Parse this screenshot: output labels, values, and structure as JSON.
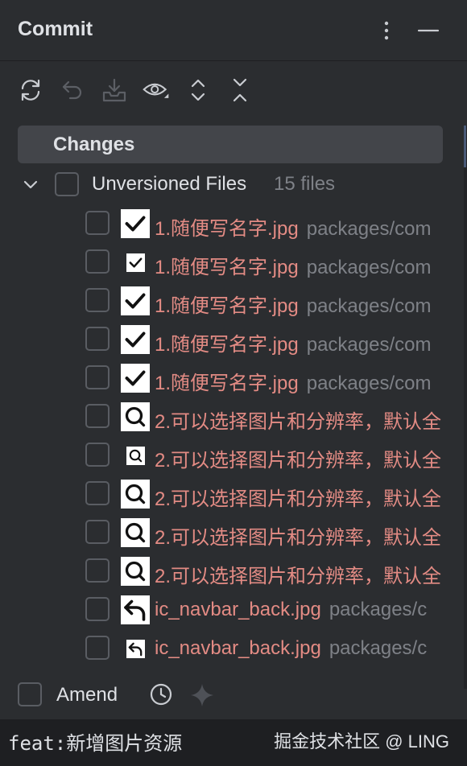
{
  "header": {
    "title": "Commit"
  },
  "changes_tab": {
    "label": "Changes"
  },
  "group": {
    "label": "Unversioned Files",
    "count": "15 files"
  },
  "files": [
    {
      "name": "1.随便写名字.jpg",
      "path": "packages/com",
      "thumb": "check",
      "thumb_size": "big"
    },
    {
      "name": "1.随便写名字.jpg",
      "path": "packages/com",
      "thumb": "check",
      "thumb_size": "small"
    },
    {
      "name": "1.随便写名字.jpg",
      "path": "packages/com",
      "thumb": "check",
      "thumb_size": "big"
    },
    {
      "name": "1.随便写名字.jpg",
      "path": "packages/com",
      "thumb": "check",
      "thumb_size": "big"
    },
    {
      "name": "1.随便写名字.jpg",
      "path": "packages/com",
      "thumb": "check",
      "thumb_size": "big"
    },
    {
      "name": "2.可以选择图片和分辨率，默认全",
      "path": "",
      "thumb": "search",
      "thumb_size": "big"
    },
    {
      "name": "2.可以选择图片和分辨率，默认全",
      "path": "",
      "thumb": "search",
      "thumb_size": "small"
    },
    {
      "name": "2.可以选择图片和分辨率，默认全",
      "path": "",
      "thumb": "search",
      "thumb_size": "big"
    },
    {
      "name": "2.可以选择图片和分辨率，默认全",
      "path": "",
      "thumb": "search",
      "thumb_size": "big"
    },
    {
      "name": "2.可以选择图片和分辨率，默认全",
      "path": "",
      "thumb": "search",
      "thumb_size": "big"
    },
    {
      "name": "ic_navbar_back.jpg",
      "path": "packages/c",
      "thumb": "back",
      "thumb_size": "big"
    },
    {
      "name": "ic_navbar_back.jpg",
      "path": "packages/c",
      "thumb": "back",
      "thumb_size": "small"
    }
  ],
  "footer": {
    "amend_label": "Amend"
  },
  "commit_message": {
    "value": "feat:新增图片资源"
  },
  "watermark": "掘金技术社区 @ LING",
  "colors": {
    "background": "#2b2d30",
    "unversioned_text": "#e38b84",
    "muted_text": "#7e8187"
  }
}
